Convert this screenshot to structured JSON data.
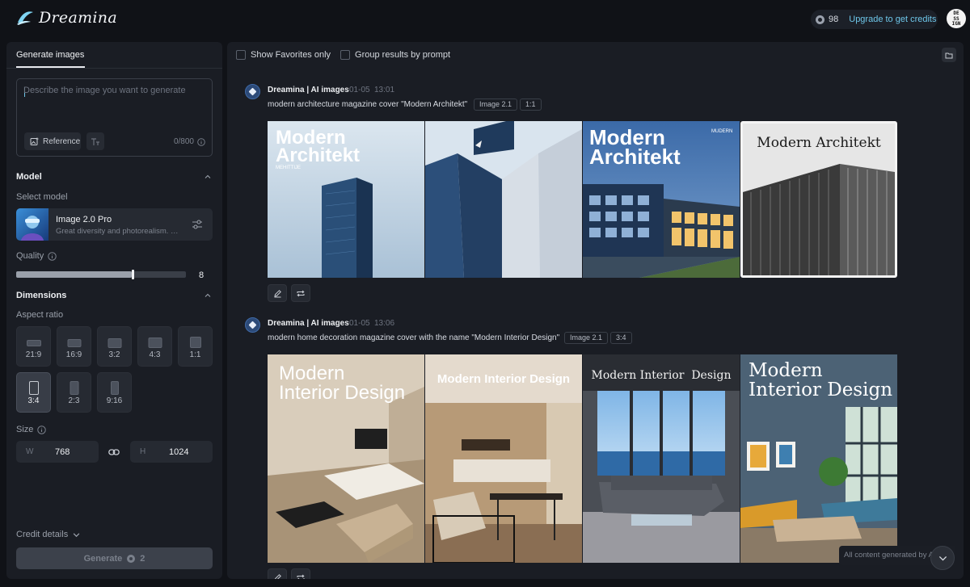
{
  "app": {
    "name": "Dreamina"
  },
  "header": {
    "credits": "98",
    "upgrade_label": "Upgrade to get credits",
    "user_badge": "DE SS IGN"
  },
  "left_panel": {
    "tab_label": "Generate images",
    "prompt": {
      "placeholder": "Describe the image you want to generate",
      "value": "",
      "char_count": "0/800",
      "reference_label": "Reference"
    },
    "model": {
      "section_label": "Model",
      "select_label": "Select model",
      "name": "Image 2.0 Pro",
      "description": "Great diversity and photorealism. Offers..."
    },
    "quality": {
      "label": "Quality",
      "value": 8,
      "max": 10,
      "value_text": "8"
    },
    "dimensions": {
      "section_label": "Dimensions",
      "aspect_label": "Aspect ratio",
      "ratios": [
        "21:9",
        "16:9",
        "3:2",
        "4:3",
        "1:1",
        "3:4",
        "2:3",
        "9:16"
      ],
      "selected": "3:4",
      "size_label": "Size",
      "width_letter": "W",
      "width": "768",
      "height_letter": "H",
      "height": "1024"
    },
    "credit_details_label": "Credit details",
    "generate": {
      "label": "Generate",
      "cost": "2"
    }
  },
  "results": {
    "show_favorites_label": "Show Favorites only",
    "group_by_prompt_label": "Group results by prompt",
    "generations": [
      {
        "source": "Dreamina | AI images",
        "date": "01-05",
        "time": "13:01",
        "prompt": "modern architecture magazine cover \"Modern Architekt\"",
        "model_tag": "Image 2.1",
        "ratio_tag": "1:1",
        "images": [
          {
            "title_1": "Modern",
            "title_2": "Architekt",
            "small": "MEHITTIJE"
          },
          {
            "title_1": "",
            "title_2": ""
          },
          {
            "title_1": "Modern",
            "title_2": "Architekt",
            "small": "MUDERN"
          },
          {
            "title_1": "Modern Architekt",
            "title_2": ""
          }
        ]
      },
      {
        "source": "Dreamina | AI images",
        "date": "01-05",
        "time": "13:06",
        "prompt": "modern home decoration magazine cover with the name \"Modern Interior Design\"",
        "model_tag": "Image 2.1",
        "ratio_tag": "3:4",
        "images": [
          {
            "title_1": "Modern",
            "title_2": "Interior Design"
          },
          {
            "title_1": "Modern Interior Design",
            "title_2": ""
          },
          {
            "title_1": "Modern Interior  Design",
            "title_2": ""
          },
          {
            "title_1": "Modern",
            "title_2": "Interior Design"
          }
        ]
      }
    ],
    "footer_notice": "All content generated by AI"
  },
  "colors": {
    "accent": "#6ec6e9",
    "panel": "#1a1d24",
    "background": "#101217"
  }
}
